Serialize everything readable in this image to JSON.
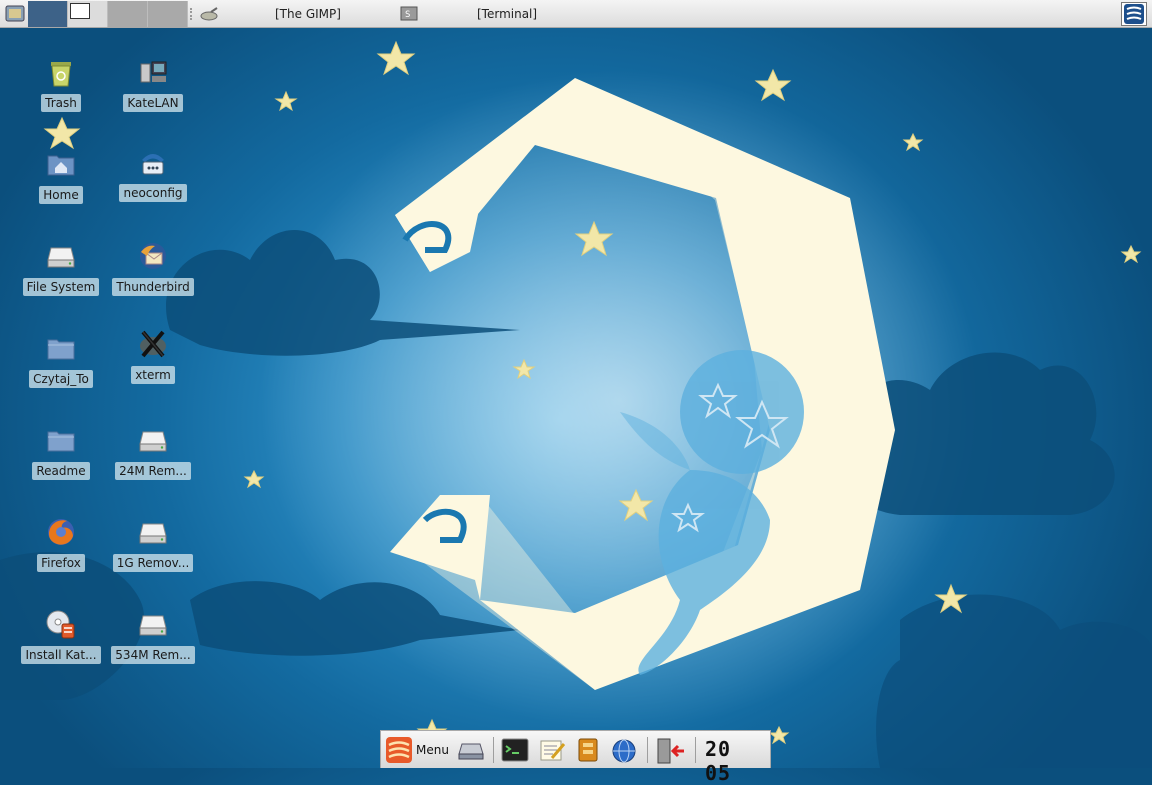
{
  "taskbar": {
    "workspaces": [
      "1",
      "2",
      "3",
      "4"
    ],
    "tasks": [
      {
        "label": "[The GIMP]",
        "icon": "gimp-icon"
      },
      {
        "label": "[Terminal]",
        "icon": "terminal-icon"
      }
    ]
  },
  "desktop": {
    "icons": [
      {
        "label": "Trash",
        "icon": "trash-icon"
      },
      {
        "label": "KateLAN",
        "icon": "network-icon"
      },
      {
        "label": "Home",
        "icon": "home-folder-icon"
      },
      {
        "label": "neoconfig",
        "icon": "phone-config-icon"
      },
      {
        "label": "File System",
        "icon": "hard-drive-icon"
      },
      {
        "label": "Thunderbird",
        "icon": "thunderbird-icon"
      },
      {
        "label": "Czytaj_To",
        "icon": "folder-icon"
      },
      {
        "label": "xterm",
        "icon": "xterm-icon"
      },
      {
        "label": "Readme",
        "icon": "folder-icon"
      },
      {
        "label": "24M Rem...",
        "icon": "removable-drive-icon"
      },
      {
        "label": "Firefox",
        "icon": "firefox-icon"
      },
      {
        "label": "1G Remov...",
        "icon": "removable-drive-icon"
      },
      {
        "label": "Install Kat...",
        "icon": "install-cd-icon"
      },
      {
        "label": "534M Rem...",
        "icon": "removable-drive-icon"
      }
    ]
  },
  "panel": {
    "menu_label": "Menu",
    "launchers": [
      "drive-icon",
      "terminal-icon",
      "text-editor-icon",
      "file-manager-icon",
      "web-browser-icon",
      "logout-icon"
    ],
    "clock": "20 05"
  },
  "colors": {
    "desktop_bg": "#1a78b0",
    "moon": "#fdf8e0",
    "label_bg": "#cde1eb"
  }
}
